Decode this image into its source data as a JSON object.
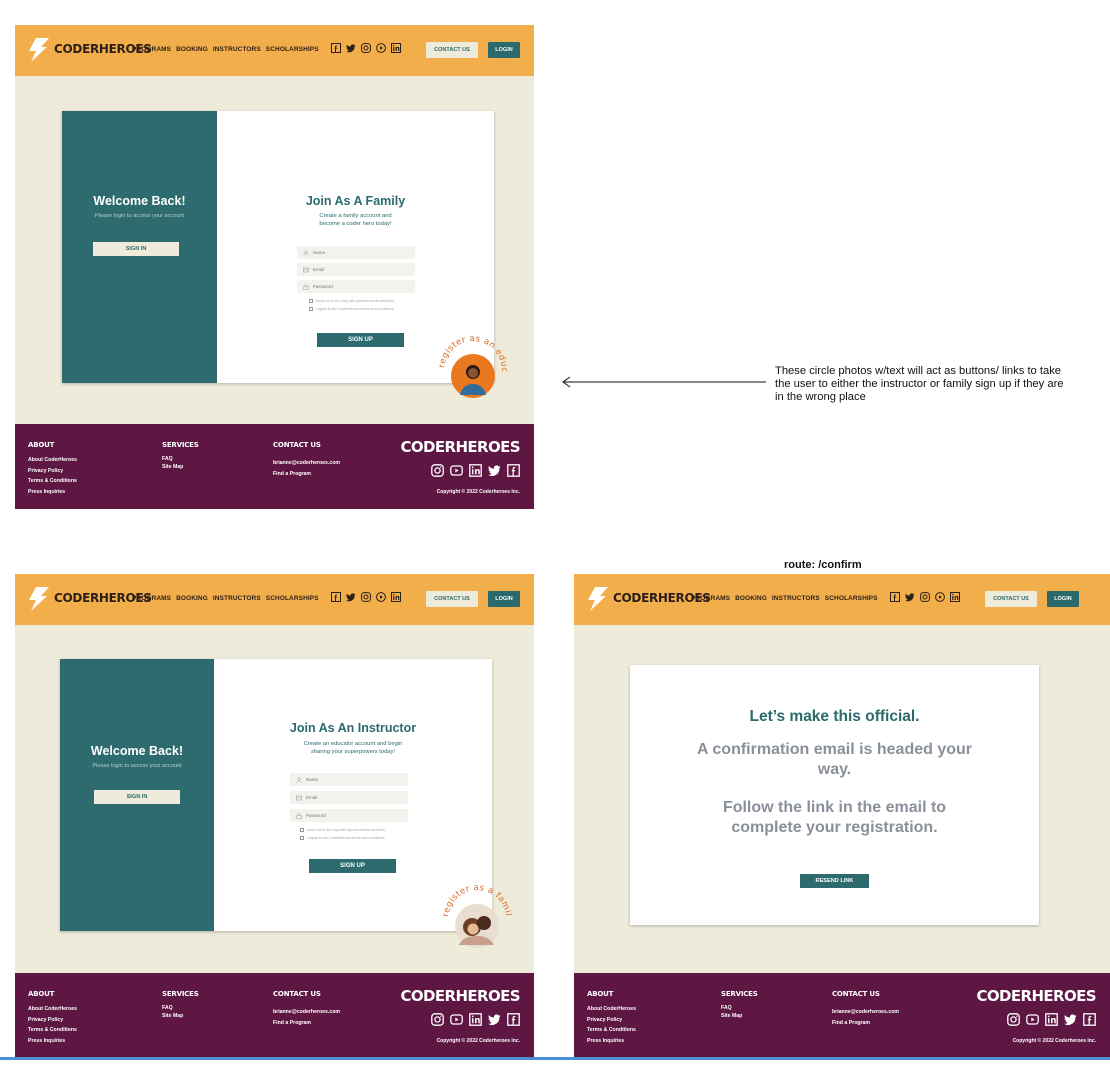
{
  "header": {
    "brand": "CODERHEROES",
    "nav": [
      "PROGRAMS",
      "BOOKING",
      "INSTRUCTORS",
      "SCHOLARSHIPS"
    ],
    "social_icons": [
      "facebook-icon",
      "twitter-icon",
      "instagram-icon",
      "youtube-icon",
      "linkedin-icon"
    ],
    "contact_label": "CONTACT US",
    "login_label": "LOGIN",
    "color": "#f2ae4a"
  },
  "login_panel": {
    "title": "Welcome Back!",
    "subtitle": "Please login to access your account",
    "button": "SIGN IN"
  },
  "family_form": {
    "title": "Join As A Family",
    "subtitle_1": "Create a family account and",
    "subtitle_2": "become a coder hero today!",
    "name_placeholder": "Name",
    "email_placeholder": "Email",
    "password_placeholder": "Password",
    "check_1": "Keep me in the loop with special events and fees",
    "check_2": "I agree to the CoderHeroes terms and conditions",
    "button": "SIGN UP",
    "badge_text": "register as an educator"
  },
  "instructor_form": {
    "title": "Join As An Instructor",
    "subtitle_1": "Create an educator account and begin",
    "subtitle_2": "sharing your superpowers  today!",
    "name_placeholder": "Name",
    "email_placeholder": "Email",
    "password_placeholder": "Password",
    "check_1": "Keep me in the loop with special events and fees",
    "check_2": "I agree to the CoderHeroes terms and conditions",
    "button": "SIGN UP",
    "badge_text": "register as a family"
  },
  "confirm": {
    "route": "route:  /confirm",
    "title": "Let’s make this official.",
    "line_1a": "A confirmation email is headed your",
    "line_1b": "way.",
    "line_2a": "Follow the link in the email to",
    "line_2b": "complete your registration.",
    "button": "RESEND LINK"
  },
  "footer": {
    "about_heading": "ABOUT",
    "about_links": [
      "About CoderHeroes",
      "Privacy Policy",
      "Terms & Conditions",
      "Press Inquiries"
    ],
    "services_heading": "SERVICES",
    "services_links": [
      "FAQ",
      "Site Map"
    ],
    "contact_heading": "CONTACT US",
    "contact_links": [
      "brianne@coderheroes.com",
      "Find a Program"
    ],
    "brand": "CODERHEROES",
    "social_icons": [
      "instagram-icon",
      "youtube-icon",
      "linkedin-icon",
      "twitter-icon",
      "facebook-icon"
    ],
    "copyright": "Copyright © 2022 Coderheroes Inc.",
    "color": "#5e1642"
  },
  "annotation": {
    "text": "These circle photos w/text will act as buttons/ links to take the user to either the instructor or family sign up if they are in the wrong place"
  }
}
